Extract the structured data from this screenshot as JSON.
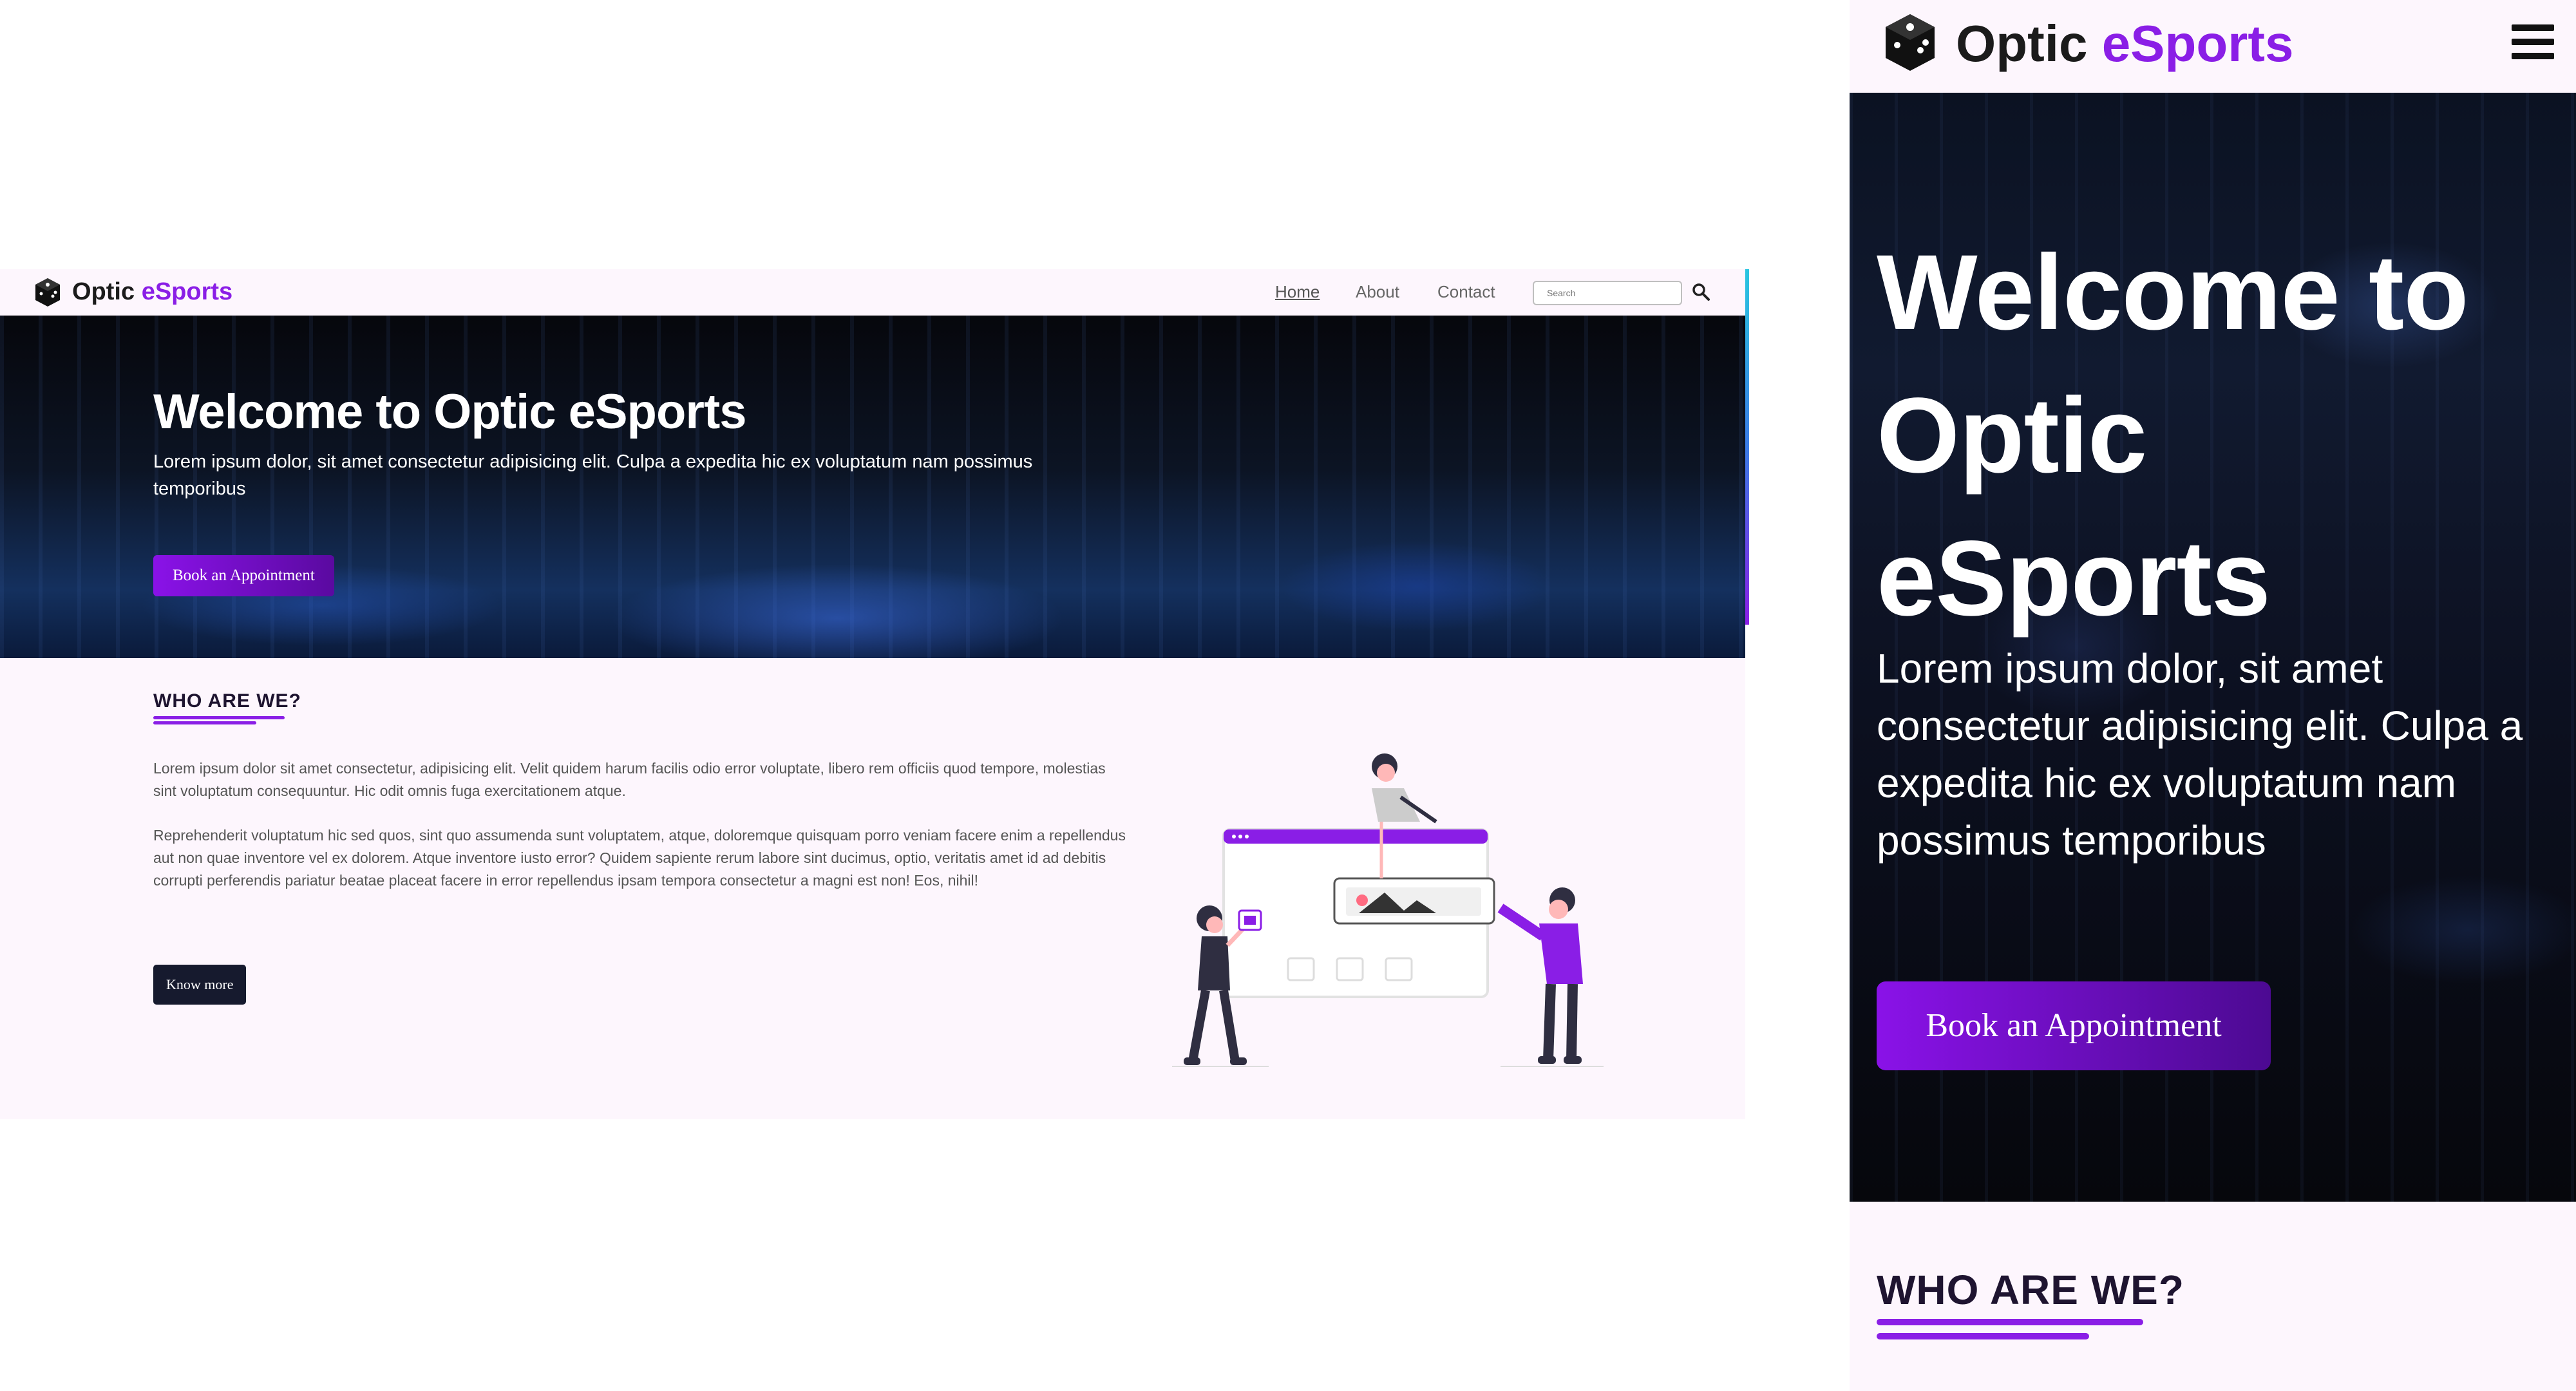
{
  "brand": {
    "name_prefix": "Optic",
    "name_accent": "eSports"
  },
  "desktop": {
    "nav": {
      "home": "Home",
      "about": "About",
      "contact": "Contact",
      "search_placeholder": "Search"
    },
    "hero": {
      "title": "Welcome to Optic eSports",
      "subtitle": "Lorem ipsum dolor, sit amet consectetur adipisicing elit. Culpa a expedita hic ex voluptatum nam possimus temporibus",
      "cta": "Book an Appointment"
    },
    "about": {
      "heading": "WHO ARE WE?",
      "paragraph1": "Lorem ipsum dolor sit amet consectetur, adipisicing elit. Velit quidem harum facilis odio error voluptate, libero rem officiis quod tempore, molestias sint voluptatum consequuntur. Hic odit omnis fuga exercitationem atque.",
      "paragraph2": "Reprehenderit voluptatum hic sed quos, sint quo assumenda sunt voluptatem, atque, doloremque quisquam porro veniam facere enim a repellendus aut non quae inventore vel ex dolorem. Atque inventore iusto error? Quidem sapiente rerum labore sint ducimus, optio, veritatis amet id ad debitis corrupti perferendis pariatur beatae placeat facere in error repellendus ipsam tempora consectetur a magni est non! Eos, nihil!",
      "cta": "Know more"
    }
  },
  "mobile": {
    "hero": {
      "title": "Welcome to Optic eSports",
      "subtitle": "Lorem ipsum dolor, sit amet consectetur adipisicing elit. Culpa a expedita hic ex voluptatum nam possimus temporibus",
      "cta": "Book an Appointment"
    },
    "about": {
      "heading": "WHO ARE WE?"
    }
  },
  "icons": {
    "logo": "dice-icon",
    "search": "search-icon",
    "menu": "hamburger-menu-icon"
  },
  "colors": {
    "accent": "#8a1ee6",
    "page_bg": "#fdf6fd",
    "dark_button": "#161a2e",
    "text_dark": "#1b1b1b"
  }
}
